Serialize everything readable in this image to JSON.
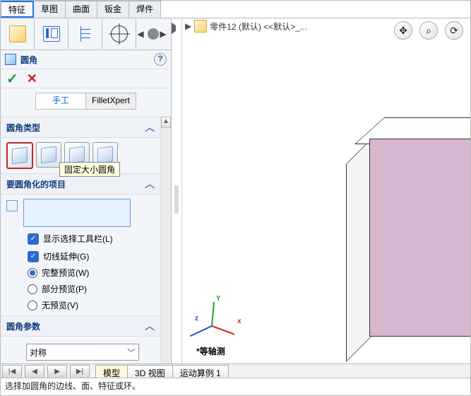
{
  "menu_tabs": {
    "features": "特征",
    "sketch": "草图",
    "surface": "曲面",
    "sheet_metal": "钣金",
    "weldments": "焊件"
  },
  "feature_manager": {
    "title": "圆角",
    "help": "?"
  },
  "mode_buttons": {
    "manual": "手工",
    "filletxpert": "FilletXpert"
  },
  "group_type_title": "圆角类型",
  "tooltip_fixed_size_fillet": "固定大小圆角",
  "group_items_title": "要圆角化的项目",
  "checkbox_show_selection_toolbar": "显示选择工具栏(L)",
  "checkbox_tangent_propagation": "切线延伸(G)",
  "radio_full_preview": "完整预览(W)",
  "radio_partial_preview": "部分预览(P)",
  "radio_no_preview": "无预览(V)",
  "group_params_title": "圆角参数",
  "params_select": "对称",
  "breadcrumb": {
    "part_name": "零件12 (默认) <<默认>_..."
  },
  "triad": {
    "x": "x",
    "y": "Y",
    "z": "z"
  },
  "view_label": "*等轴测",
  "bottom_tabs": {
    "model": "模型",
    "view3d": "3D 视图",
    "motion": "运动算例 1"
  },
  "scroll": {
    "back_end": "|◀",
    "back": "◀",
    "fwd": "▶",
    "fwd_end": "▶|"
  },
  "scrollbar": {
    "up": "▲",
    "down": "▼"
  },
  "status_bar": "选择加圆角的边线、面、特征或环。",
  "chevrons": {
    "up": "︿",
    "down": "﹀"
  },
  "misc": {
    "arrow_left": "◀",
    "arrow_right": "▶",
    "ok": "✓",
    "cancel": "✕",
    "dropdown": "﹀"
  }
}
